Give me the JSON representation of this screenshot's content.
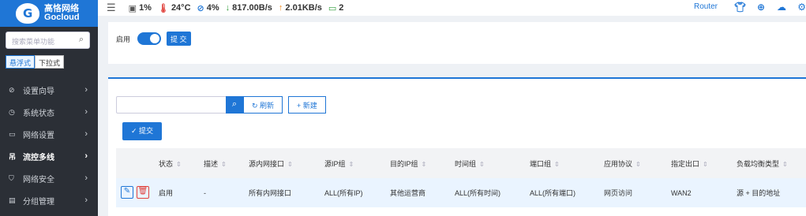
{
  "brand": {
    "name_cn": "高恪网络",
    "name_en": "Gocloud"
  },
  "sidebar": {
    "search_placeholder": "搜索菜单功能",
    "modes": [
      "悬浮式",
      "下拉式"
    ],
    "items": [
      {
        "label": "设置向导",
        "icon": "compass-icon"
      },
      {
        "label": "系统状态",
        "icon": "gauge-icon"
      },
      {
        "label": "网络设置",
        "icon": "monitor-icon"
      },
      {
        "label": "流控多线",
        "icon": "split-icon"
      },
      {
        "label": "网络安全",
        "icon": "shield-icon"
      },
      {
        "label": "分组管理",
        "icon": "group-icon"
      }
    ]
  },
  "topbar": {
    "cpu": "1%",
    "temp": "24°C",
    "mem": "4%",
    "down": "817.00B/s",
    "up": "2.01KB/s",
    "online": "2",
    "router": "Router"
  },
  "panel1": {
    "enable_label": "启用",
    "submit": "提 交"
  },
  "toolbar": {
    "refresh": "刷新",
    "new": "新建",
    "submit": "提交"
  },
  "table": {
    "headers": [
      "状态",
      "描述",
      "源内网接口",
      "源IP组",
      "目的IP组",
      "时间组",
      "端口组",
      "应用协议",
      "指定出口",
      "负载均衡类型"
    ],
    "rows": [
      [
        "启用",
        "-",
        "所有内网接口",
        "ALL(所有IP)",
        "其他运营商",
        "ALL(所有时间)",
        "ALL(所有端口)",
        "网页访问",
        "WAN2",
        "源 + 目的地址"
      ]
    ]
  },
  "colors": {
    "accent": "#1f76d6",
    "sidebar": "#2b2f36"
  }
}
